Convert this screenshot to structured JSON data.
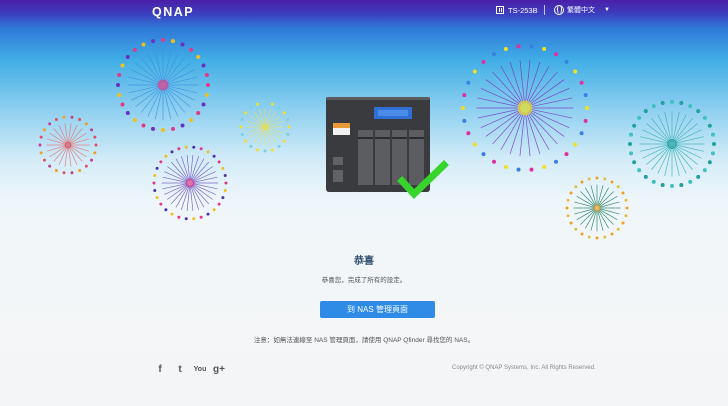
{
  "header": {
    "logo": "QNAP",
    "model_label": "TS-253B",
    "language_label": "繁體中文",
    "language_caret": "▼"
  },
  "main": {
    "title": "恭喜",
    "subtitle": "恭喜您，完成了所有的設定。",
    "button_label": "到 NAS 管理頁面",
    "note": "注意：如無法連線至 NAS 管理頁面，請使用 QNAP Qfinder 尋找您的 NAS。"
  },
  "footer": {
    "social_icons": [
      {
        "name": "facebook-icon",
        "glyph": "f"
      },
      {
        "name": "twitter-icon",
        "glyph": "t"
      },
      {
        "name": "youtube-icon",
        "glyph": "You"
      },
      {
        "name": "google-plus-icon",
        "glyph": "g+"
      }
    ],
    "copyright": "Copyright © QNAP Systems, Inc. All Rights Reserved."
  },
  "colors": {
    "accent": "#2f8be6",
    "check": "#37d42b"
  }
}
